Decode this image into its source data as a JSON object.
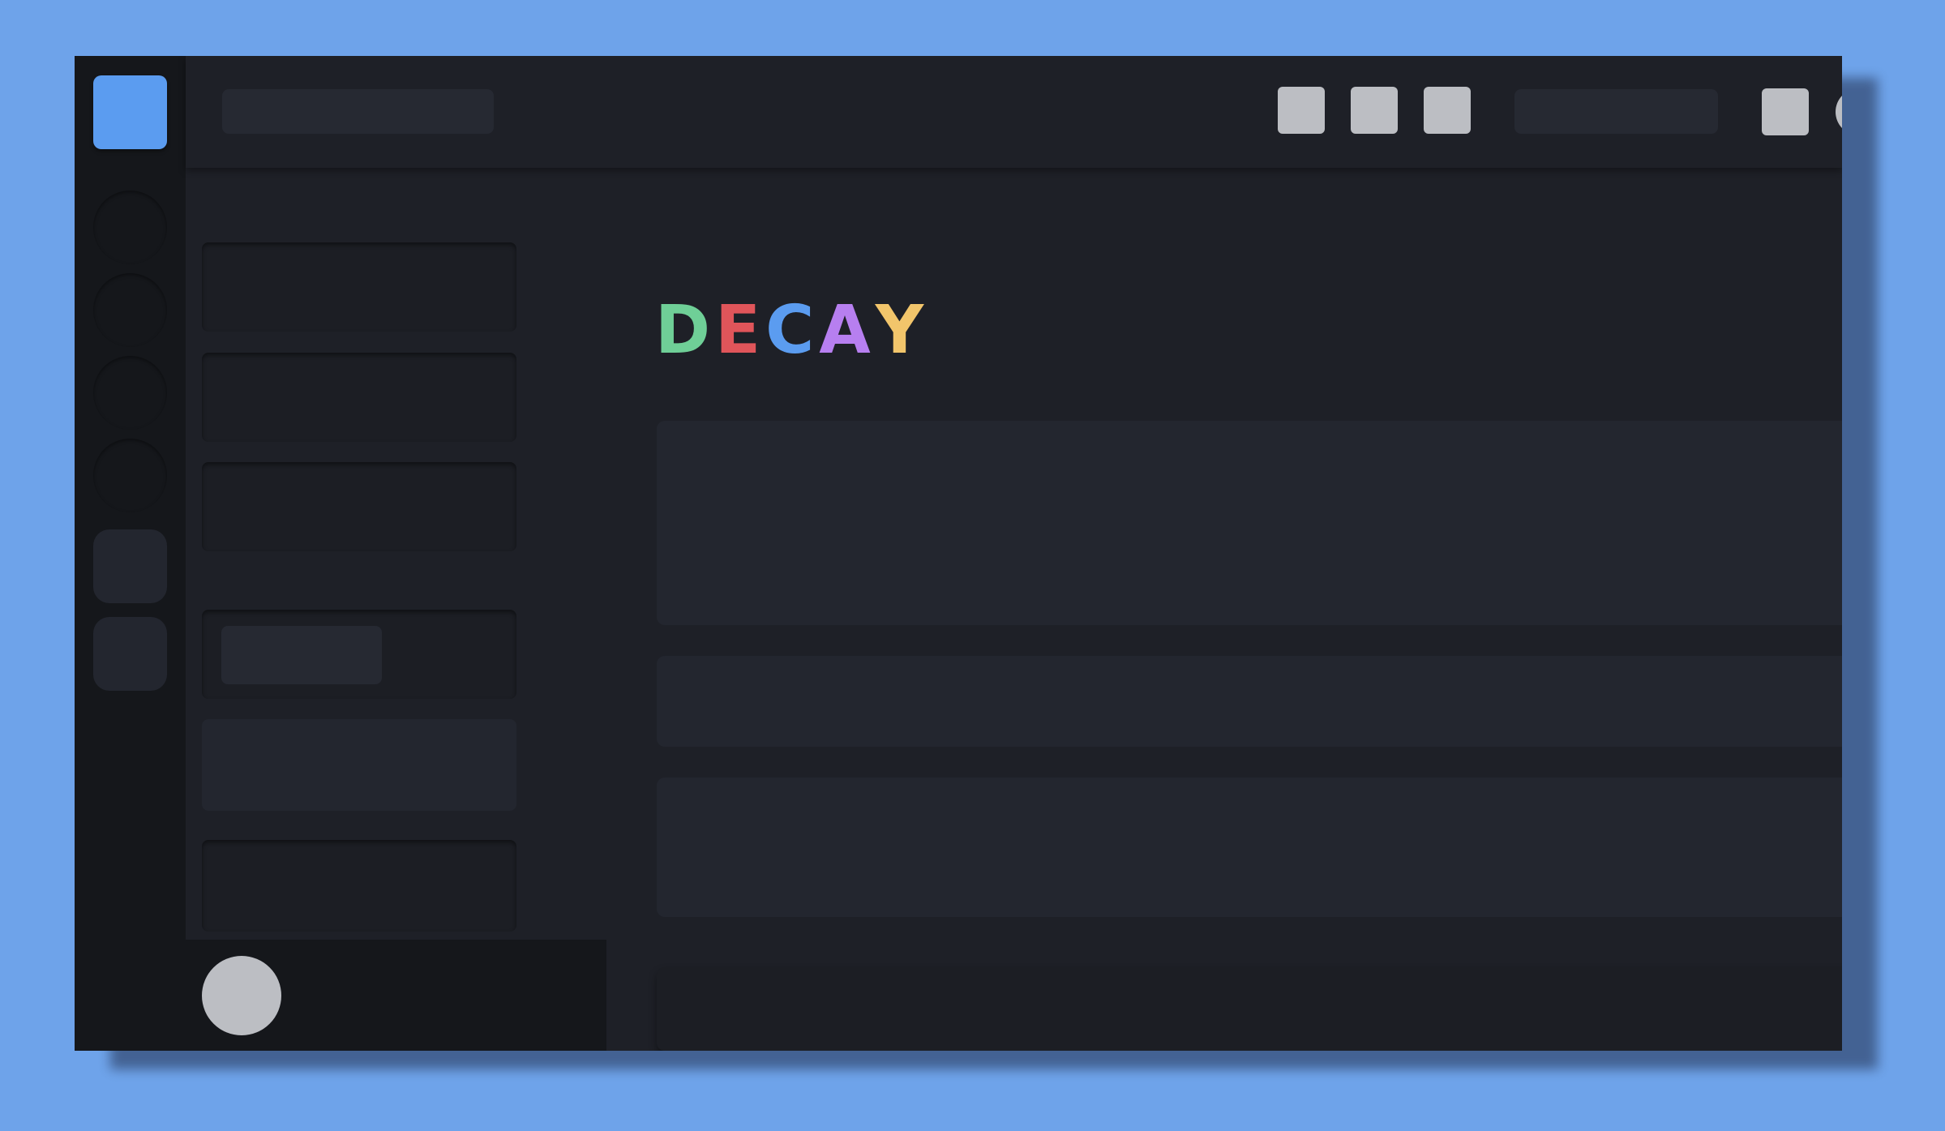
{
  "app": {
    "title_letters": [
      {
        "char": "D",
        "color": "#6fcf97"
      },
      {
        "char": "E",
        "color": "#e0555a"
      },
      {
        "char": "C",
        "color": "#5b9cf0"
      },
      {
        "char": "A",
        "color": "#b77ff0"
      },
      {
        "char": "Y",
        "color": "#f2c56b"
      }
    ]
  },
  "colors": {
    "background": "#6ea3ea",
    "rail": "#15171b",
    "surface": "#1e2027",
    "panel": "#1a1c22",
    "placeholder": "#262932",
    "card": "#23262f",
    "sunk_card": "#1c1e24",
    "accent": "#5b9cf0",
    "light": "#bcbec3"
  },
  "server_rail": {
    "items": [
      {
        "kind": "home",
        "icon": "app-logo-icon"
      },
      {
        "kind": "server",
        "icon": "server-icon"
      },
      {
        "kind": "server",
        "icon": "server-icon"
      },
      {
        "kind": "server",
        "icon": "server-icon"
      },
      {
        "kind": "server",
        "icon": "server-icon"
      },
      {
        "kind": "action",
        "icon": "add-server-icon"
      },
      {
        "kind": "action",
        "icon": "explore-icon"
      }
    ]
  },
  "topbar": {
    "tools": [
      "tool-icon",
      "tool-icon",
      "tool-icon",
      "tool-icon"
    ],
    "avatar": "user-avatar-icon"
  },
  "channels": {
    "count_top": 3,
    "count_bottom": 3,
    "selected_index": 4
  },
  "main": {
    "content_blocks": 3,
    "has_message_input": true
  }
}
